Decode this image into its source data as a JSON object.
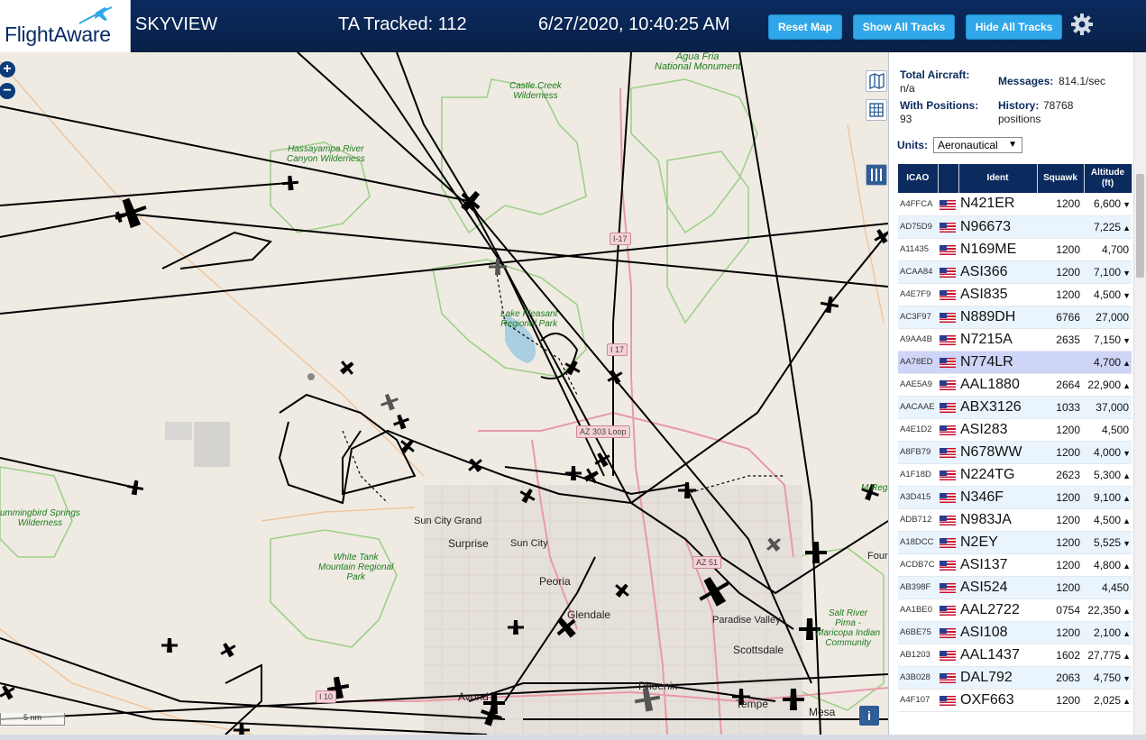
{
  "header": {
    "logo_text": "FlightAware",
    "title": "SKYVIEW",
    "tracked": "TA Tracked: 112",
    "clock": "6/27/2020, 10:40:25 AM",
    "buttons": {
      "reset": "Reset Map",
      "show": "Show All Tracks",
      "hide": "Hide All Tracks"
    },
    "settings_icon": "gear-icon"
  },
  "map": {
    "zoom_in": "+",
    "zoom_out": "−",
    "scale_label": "5 nm",
    "info_label": "i",
    "controls": [
      "map-layers-icon",
      "grid-icon",
      "columns-icon"
    ],
    "labels": {
      "agua_fria": "Agua Fria National Monument",
      "castle_creek": "Castle Creek Wilderness",
      "hassayampa": "Hassayampa River Canyon Wilderness",
      "lake_pleasant": "Lake Pleasant Regional Park",
      "white_tank": "White Tank Mountain Regional Park",
      "hummingbird": "ummingbird Springs Wilderness",
      "salt_river": "Salt River Pima - Maricopa Indian Community",
      "mc_regional": "M Regional",
      "four": "Four"
    },
    "cities": {
      "sun_city_grand": "Sun City Grand",
      "surprise": "Surprise",
      "sun_city": "Sun City",
      "peoria": "Peoria",
      "glendale": "Glendale",
      "paradise_valley": "Paradise Valley",
      "scottsdale": "Scottsdale",
      "phoenix": "Phoenix",
      "tempe": "Tempe",
      "mesa": "Mesa",
      "avondale": "Avond"
    },
    "roads": {
      "i17a": "I-17",
      "i17b": "I 17",
      "az303": "AZ 303 Loop",
      "az51": "AZ 51",
      "i10": "I 10"
    }
  },
  "panel": {
    "total_label": "Total Aircraft:",
    "total_value": "n/a",
    "positions_label": "With Positions:",
    "positions_value": "93",
    "messages_label": "Messages:",
    "messages_value": "814.1/sec",
    "history_label": "History:",
    "history_value": "78768",
    "history_unit": "positions",
    "units_label": "Units:",
    "units_value": "Aeronautical",
    "columns": {
      "icao": "ICAO",
      "flag": "",
      "ident": "Ident",
      "squawk": "Squawk",
      "altitude": "Altitude (ft)"
    },
    "rows": [
      {
        "icao": "A4FFCA",
        "ident": "N421ER",
        "squawk": "1200",
        "alt": "6,600",
        "trend": "▼"
      },
      {
        "icao": "AD75D9",
        "ident": "N96673",
        "squawk": "",
        "alt": "7,225",
        "trend": "▲"
      },
      {
        "icao": "A11435",
        "ident": "N169ME",
        "squawk": "1200",
        "alt": "4,700",
        "trend": ""
      },
      {
        "icao": "ACAA84",
        "ident": "ASI366",
        "squawk": "1200",
        "alt": "7,100",
        "trend": "▼"
      },
      {
        "icao": "A4E7F9",
        "ident": "ASI835",
        "squawk": "1200",
        "alt": "4,500",
        "trend": "▼"
      },
      {
        "icao": "AC3F97",
        "ident": "N889DH",
        "squawk": "6766",
        "alt": "27,000",
        "trend": ""
      },
      {
        "icao": "A9AA4B",
        "ident": "N7215A",
        "squawk": "2635",
        "alt": "7,150",
        "trend": "▼"
      },
      {
        "icao": "AA78ED",
        "ident": "N774LR",
        "squawk": "",
        "alt": "4,700",
        "trend": "▲"
      },
      {
        "icao": "AAE5A9",
        "ident": "AAL1880",
        "squawk": "2664",
        "alt": "22,900",
        "trend": "▲"
      },
      {
        "icao": "AACAAE",
        "ident": "ABX3126",
        "squawk": "1033",
        "alt": "37,000",
        "trend": ""
      },
      {
        "icao": "A4E1D2",
        "ident": "ASI283",
        "squawk": "1200",
        "alt": "4,500",
        "trend": ""
      },
      {
        "icao": "A8FB79",
        "ident": "N678WW",
        "squawk": "1200",
        "alt": "4,000",
        "trend": "▼"
      },
      {
        "icao": "A1F18D",
        "ident": "N224TG",
        "squawk": "2623",
        "alt": "5,300",
        "trend": "▲"
      },
      {
        "icao": "A3D415",
        "ident": "N346F",
        "squawk": "1200",
        "alt": "9,100",
        "trend": "▲"
      },
      {
        "icao": "ADB712",
        "ident": "N983JA",
        "squawk": "1200",
        "alt": "4,500",
        "trend": "▲"
      },
      {
        "icao": "A18DCC",
        "ident": "N2EY",
        "squawk": "1200",
        "alt": "5,525",
        "trend": "▼"
      },
      {
        "icao": "ACDB7C",
        "ident": "ASI137",
        "squawk": "1200",
        "alt": "4,800",
        "trend": "▲"
      },
      {
        "icao": "AB398F",
        "ident": "ASI524",
        "squawk": "1200",
        "alt": "4,450",
        "trend": ""
      },
      {
        "icao": "AA1BE0",
        "ident": "AAL2722",
        "squawk": "0754",
        "alt": "22,350",
        "trend": "▲"
      },
      {
        "icao": "A6BE75",
        "ident": "ASI108",
        "squawk": "1200",
        "alt": "2,100",
        "trend": "▲"
      },
      {
        "icao": "AB1203",
        "ident": "AAL1437",
        "squawk": "1602",
        "alt": "27,775",
        "trend": "▲"
      },
      {
        "icao": "A3B028",
        "ident": "DAL792",
        "squawk": "2063",
        "alt": "4,750",
        "trend": "▼"
      },
      {
        "icao": "A4F107",
        "ident": "OXF663",
        "squawk": "1200",
        "alt": "2,025",
        "trend": "▲"
      }
    ],
    "selected_icao": "AA78ED"
  }
}
